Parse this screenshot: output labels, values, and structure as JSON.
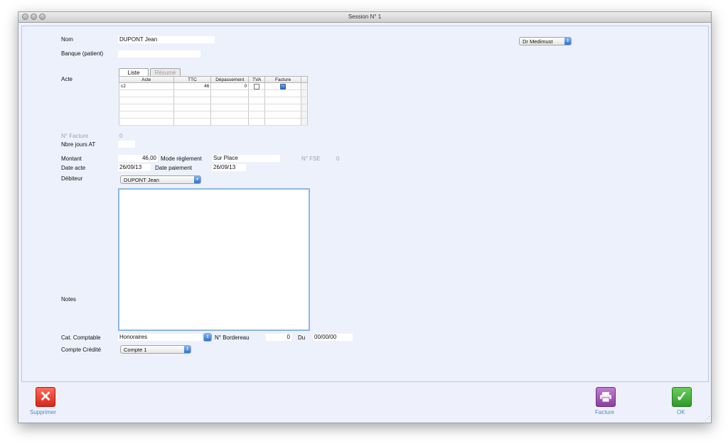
{
  "window": {
    "title": "Session N° 1"
  },
  "form": {
    "nom": {
      "label": "Nom",
      "value": "DUPONT  Jean"
    },
    "banque": {
      "label": "Banque (patient)",
      "value": ""
    },
    "doctor_select": "Dr Medimust",
    "acte": {
      "label": "Acte",
      "tabs": [
        "Liste",
        "Résumé"
      ],
      "columns": [
        "Acte",
        "TTC",
        "Dépassement",
        "TVA",
        "Facture"
      ],
      "rows": [
        {
          "acte": "c2",
          "ttc": "46",
          "depassement": "0",
          "tva": false,
          "facture": true
        }
      ]
    },
    "facture_num": {
      "label": "N° Facture",
      "value": "0"
    },
    "jours_at": {
      "label": "Nbre jours AT",
      "value": ""
    },
    "montant": {
      "label": "Montant",
      "value": "46,00"
    },
    "mode_reglement": {
      "label": "Mode règlement",
      "value": "Sur Place"
    },
    "fse": {
      "label": "N° FSE",
      "value": "0"
    },
    "date_acte": {
      "label": "Date acte",
      "value": "26/09/13"
    },
    "date_paiement": {
      "label": "Date paiement",
      "value": "26/09/13"
    },
    "debiteur": {
      "label": "Débiteur",
      "value": "DUPONT  Jean"
    },
    "notes": {
      "label": "Notes",
      "value": ""
    },
    "cat_comptable": {
      "label": "Cat. Comptable",
      "value": "Honoraires"
    },
    "bordereau": {
      "label": "N° Bordereau",
      "value": "0"
    },
    "du": {
      "label": "Du",
      "value": "00/00/00"
    },
    "compte_credite": {
      "label": "Compte Crédité",
      "value": "Compte 1"
    }
  },
  "footer": {
    "delete_label": "Supprimer",
    "invoice_label": "Facture",
    "ok_label": "OK"
  },
  "colors": {
    "delete": "#e8392d",
    "invoice": "#9d4fb0",
    "ok": "#3aa23a",
    "accent": "#4f86c9"
  }
}
